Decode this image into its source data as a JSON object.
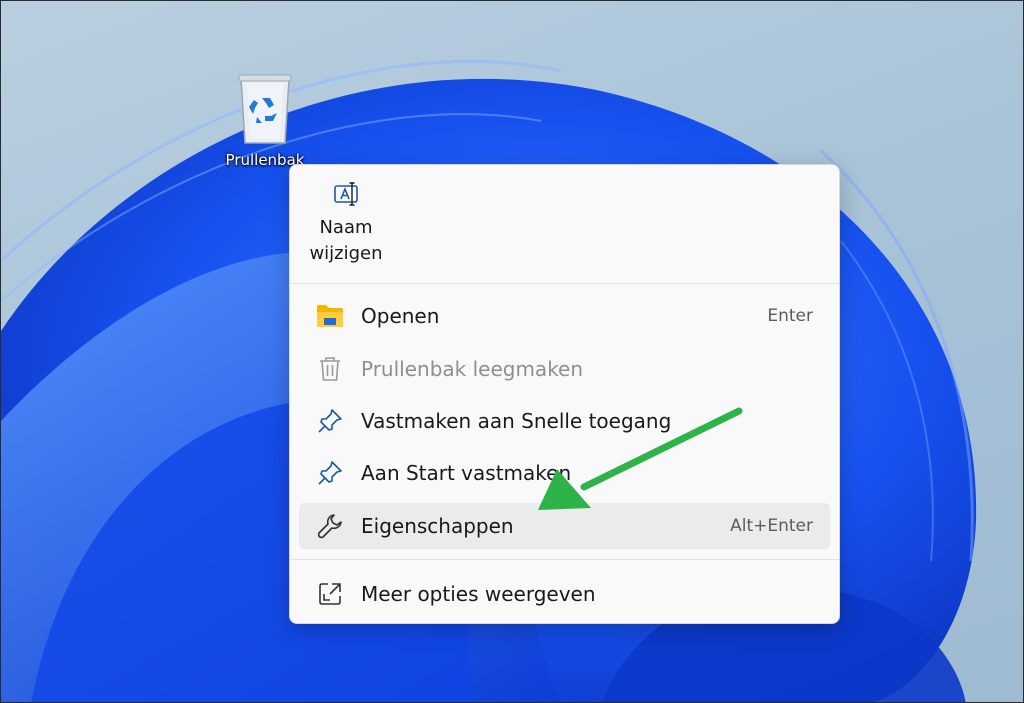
{
  "desktop": {
    "recycle_bin_label": "Prullenbak"
  },
  "context_menu": {
    "quick_action": {
      "label_line1": "Naam",
      "label_line2": "wijzigen",
      "icon": "rename-icon"
    },
    "items": [
      {
        "label": "Openen",
        "shortcut": "Enter",
        "icon": "folder-icon",
        "disabled": false
      },
      {
        "label": "Prullenbak leegmaken",
        "shortcut": "",
        "icon": "trash-icon",
        "disabled": true
      },
      {
        "label": "Vastmaken aan Snelle toegang",
        "shortcut": "",
        "icon": "pin-icon",
        "disabled": false
      },
      {
        "label": "Aan Start vastmaken",
        "shortcut": "",
        "icon": "pin-icon",
        "disabled": false
      },
      {
        "label": "Eigenschappen",
        "shortcut": "Alt+Enter",
        "icon": "wrench-icon",
        "disabled": false,
        "highlighted": true
      },
      {
        "label": "Meer opties weergeven",
        "shortcut": "",
        "icon": "open-external-icon",
        "disabled": false
      }
    ]
  },
  "annotation": {
    "arrow_color": "#2db34a"
  },
  "colors": {
    "accent": "#0067c0",
    "wallpaper_blue": "#1a5cff"
  }
}
